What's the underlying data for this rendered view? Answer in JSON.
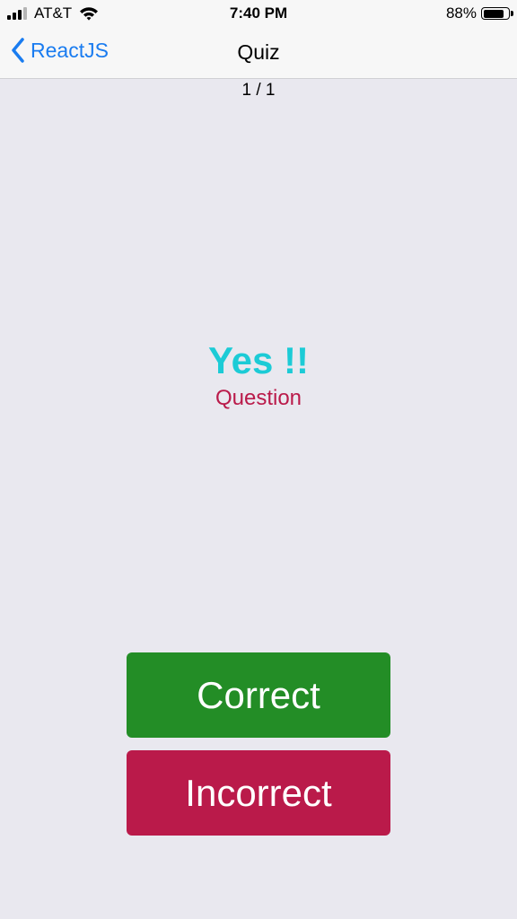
{
  "status_bar": {
    "carrier": "AT&T",
    "time": "7:40 PM",
    "battery_percent_label": "88%",
    "battery_level": 0.88,
    "signal_bars_filled": 3,
    "signal_bars_total": 4
  },
  "nav": {
    "back_label": "ReactJS",
    "title": "Quiz",
    "accent_color": "#1a7cf0"
  },
  "quiz": {
    "counter": "1 / 1",
    "answer": "Yes !!",
    "question_label": "Question",
    "answer_color": "#1ccbd6",
    "question_color": "#ba1a4a"
  },
  "buttons": {
    "correct_label": "Correct",
    "incorrect_label": "Incorrect",
    "correct_color": "#238d26",
    "incorrect_color": "#ba1a4a"
  }
}
